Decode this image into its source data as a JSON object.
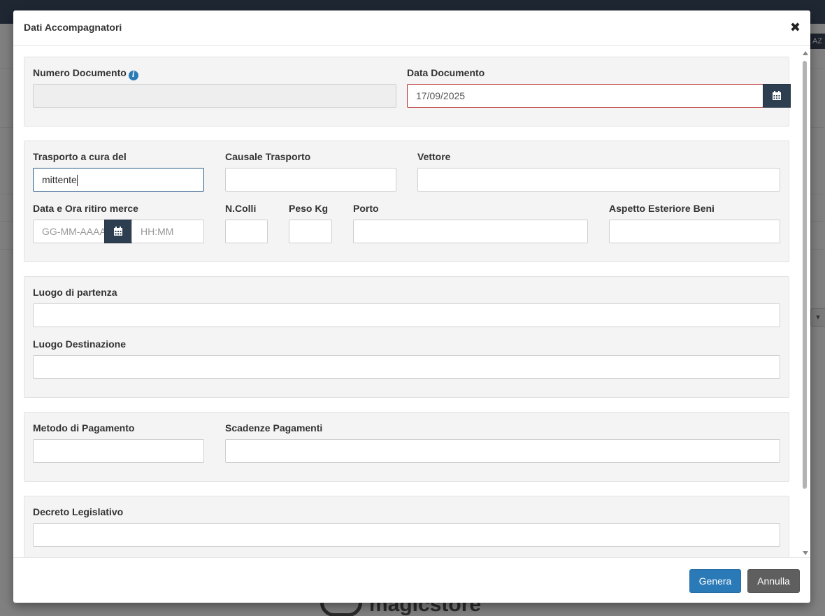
{
  "background": {
    "tag": "AZ",
    "logo_text": "magicstore"
  },
  "modal": {
    "title": "Dati Accompagnatori",
    "close_icon": "close-icon"
  },
  "documento": {
    "numero_label": "Numero Documento",
    "numero_value": "",
    "data_label": "Data Documento",
    "data_value": "17/09/2025"
  },
  "trasporto": {
    "cura_label": "Trasporto a cura del",
    "cura_value": "mittente",
    "causale_label": "Causale Trasporto",
    "causale_value": "",
    "vettore_label": "Vettore",
    "vettore_value": "",
    "ritiro_label": "Data e Ora ritiro merce",
    "ritiro_date_placeholder": "GG-MM-AAAA",
    "ritiro_time_placeholder": "HH:MM",
    "colli_label": "N.Colli",
    "colli_value": "",
    "peso_label": "Peso Kg",
    "peso_value": "",
    "porto_label": "Porto",
    "porto_value": "",
    "aspetto_label": "Aspetto Esteriore Beni",
    "aspetto_value": ""
  },
  "luoghi": {
    "partenza_label": "Luogo di partenza",
    "partenza_value": "",
    "destinazione_label": "Luogo Destinazione",
    "destinazione_value": ""
  },
  "pagamento": {
    "metodo_label": "Metodo di Pagamento",
    "metodo_value": "",
    "scadenze_label": "Scadenze Pagamenti",
    "scadenze_value": ""
  },
  "decreto": {
    "label": "Decreto Legislativo",
    "value": ""
  },
  "footer": {
    "genera_label": "Genera",
    "annulla_label": "Annulla"
  },
  "colors": {
    "primary": "#2a7ab8",
    "addon": "#2c3e50",
    "invalid_border": "#b92e2e",
    "secondary_button": "#5f5f5f"
  }
}
